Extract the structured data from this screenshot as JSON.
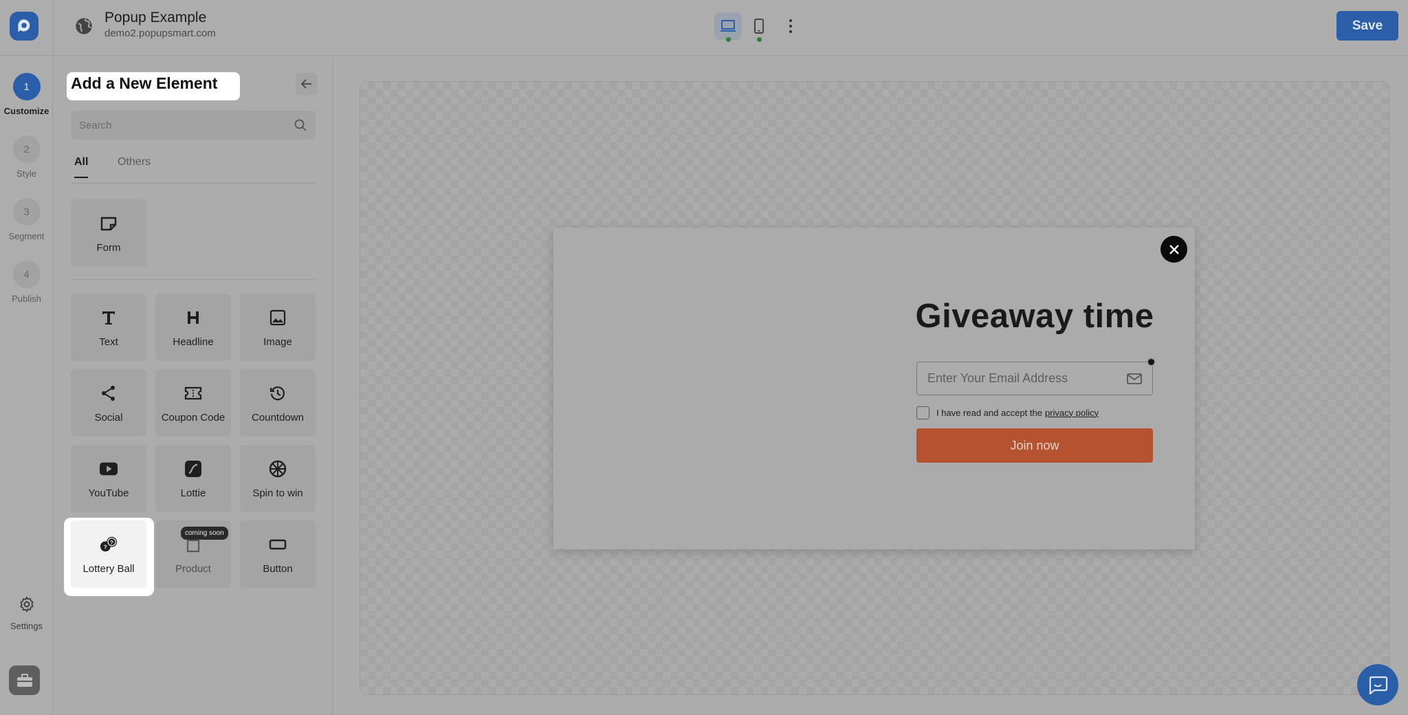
{
  "header": {
    "title": "Popup Example",
    "url": "demo2.popupsmart.com",
    "save_label": "Save"
  },
  "steps": [
    {
      "num": "1",
      "label": "Customize",
      "active": true
    },
    {
      "num": "2",
      "label": "Style",
      "active": false
    },
    {
      "num": "3",
      "label": "Segment",
      "active": false
    },
    {
      "num": "4",
      "label": "Publish",
      "active": false
    }
  ],
  "rail": {
    "settings_label": "Settings"
  },
  "panel": {
    "title": "Add a New Element",
    "search_placeholder": "Search",
    "tabs": [
      "All",
      "Others"
    ],
    "form_tile": {
      "label": "Form",
      "icon": "form-icon"
    },
    "tiles": [
      {
        "label": "Text",
        "icon": "text-icon"
      },
      {
        "label": "Headline",
        "icon": "headline-icon"
      },
      {
        "label": "Image",
        "icon": "image-icon"
      },
      {
        "label": "Social",
        "icon": "share-icon"
      },
      {
        "label": "Coupon Code",
        "icon": "coupon-icon"
      },
      {
        "label": "Countdown",
        "icon": "countdown-icon"
      },
      {
        "label": "YouTube",
        "icon": "youtube-icon"
      },
      {
        "label": "Lottie",
        "icon": "lottie-icon"
      },
      {
        "label": "Spin to win",
        "icon": "wheel-icon"
      },
      {
        "label": "Lottery Ball",
        "icon": "lottery-ball-icon"
      },
      {
        "label": "Product",
        "icon": "product-icon"
      },
      {
        "label": "Button",
        "icon": "button-icon"
      }
    ],
    "coming_soon_badge": "coming soon"
  },
  "popup": {
    "headline": "Giveaway time",
    "email_placeholder": "Enter Your Email Address",
    "consent_text": "I have read and accept the",
    "consent_link": "privacy policy",
    "button_label": "Join now"
  },
  "colors": {
    "accent": "#2b5ea8",
    "cta": "#b5522f"
  }
}
